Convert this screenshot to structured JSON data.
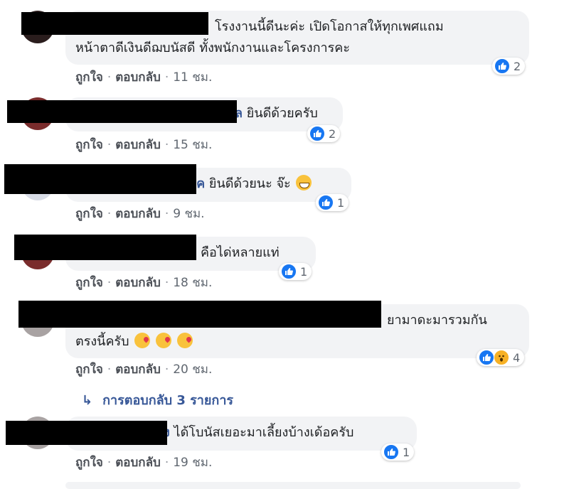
{
  "comments": [
    {
      "text_line1": "โรงงานนี้ดีนะค่ะ เปิดโอกาสให้ทุกเพศแถม",
      "text_line2": "หน้าตาดีเงินดีฌบนัสดี ทั้งพนักงานและโครงการคะ",
      "name_tail": "",
      "like_label": "ถูกใจ",
      "reply_label": "ตอบกลับ",
      "time": "11 ชม.",
      "reaction_count": "2"
    },
    {
      "name_tail": "ล",
      "text": "ยินดีด้วยครับ",
      "like_label": "ถูกใจ",
      "reply_label": "ตอบกลับ",
      "time": "15 ชม.",
      "reaction_count": "2"
    },
    {
      "name_tail": "าค",
      "text": "ยินดีด้วยนะ จ๊ะ",
      "emoji": "grinning-face",
      "like_label": "ถูกใจ",
      "reply_label": "ตอบกลับ",
      "time": "9 ชม.",
      "reaction_count": "1"
    },
    {
      "name_tail": "",
      "text": "คือได่หลายแท่",
      "like_label": "ถูกใจ",
      "reply_label": "ตอบกลับ",
      "time": "18 ชม.",
      "reaction_count": "1"
    },
    {
      "name_tail": "",
      "text_line1": "ยามาดะมารวมกัน",
      "text_line2": "ตรงนี้ครับ",
      "emoji": "kissing-face",
      "like_label": "ถูกใจ",
      "reply_label": "ตอบกลับ",
      "time": "20 ชม.",
      "reaction_count": "4"
    },
    {
      "name_tail": "ง",
      "text": "ได้โบนัสเยอะมาเลี้ยงบ้างเด้อครับ",
      "like_label": "ถูกใจ",
      "reply_label": "ตอบกลับ",
      "time": "19 ชม.",
      "reaction_count": "1"
    }
  ],
  "replies_link": "การตอบกลับ 3 รายการ",
  "colors": {
    "link": "#385898",
    "bubble": "#f2f3f5",
    "like": "#1877f2",
    "wow": "#f7b125"
  }
}
